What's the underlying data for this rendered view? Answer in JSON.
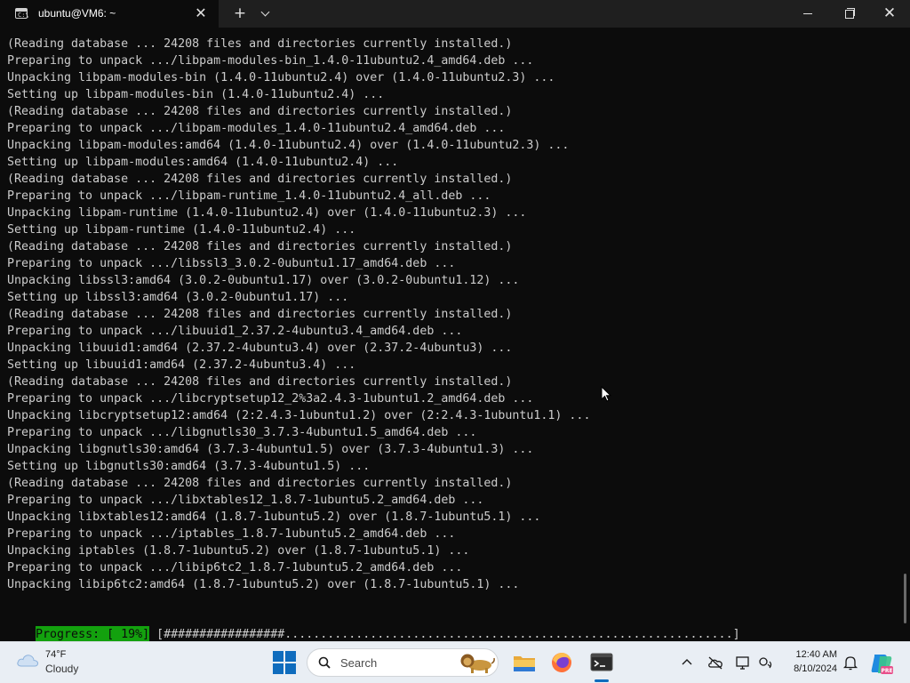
{
  "window": {
    "tab_title": "ubuntu@VM6: ~",
    "tab_icon_text": "C:\\",
    "tab_close_glyph": "✕",
    "new_tab_glyph": "+",
    "close_glyph": "✕"
  },
  "terminal": {
    "lines": [
      "(Reading database ... 24208 files and directories currently installed.)",
      "Preparing to unpack .../libpam-modules-bin_1.4.0-11ubuntu2.4_amd64.deb ...",
      "Unpacking libpam-modules-bin (1.4.0-11ubuntu2.4) over (1.4.0-11ubuntu2.3) ...",
      "Setting up libpam-modules-bin (1.4.0-11ubuntu2.4) ...",
      "(Reading database ... 24208 files and directories currently installed.)",
      "Preparing to unpack .../libpam-modules_1.4.0-11ubuntu2.4_amd64.deb ...",
      "Unpacking libpam-modules:amd64 (1.4.0-11ubuntu2.4) over (1.4.0-11ubuntu2.3) ...",
      "Setting up libpam-modules:amd64 (1.4.0-11ubuntu2.4) ...",
      "(Reading database ... 24208 files and directories currently installed.)",
      "Preparing to unpack .../libpam-runtime_1.4.0-11ubuntu2.4_all.deb ...",
      "Unpacking libpam-runtime (1.4.0-11ubuntu2.4) over (1.4.0-11ubuntu2.3) ...",
      "Setting up libpam-runtime (1.4.0-11ubuntu2.4) ...",
      "(Reading database ... 24208 files and directories currently installed.)",
      "Preparing to unpack .../libssl3_3.0.2-0ubuntu1.17_amd64.deb ...",
      "Unpacking libssl3:amd64 (3.0.2-0ubuntu1.17) over (3.0.2-0ubuntu1.12) ...",
      "Setting up libssl3:amd64 (3.0.2-0ubuntu1.17) ...",
      "(Reading database ... 24208 files and directories currently installed.)",
      "Preparing to unpack .../libuuid1_2.37.2-4ubuntu3.4_amd64.deb ...",
      "Unpacking libuuid1:amd64 (2.37.2-4ubuntu3.4) over (2.37.2-4ubuntu3) ...",
      "Setting up libuuid1:amd64 (2.37.2-4ubuntu3.4) ...",
      "(Reading database ... 24208 files and directories currently installed.)",
      "Preparing to unpack .../libcryptsetup12_2%3a2.4.3-1ubuntu1.2_amd64.deb ...",
      "Unpacking libcryptsetup12:amd64 (2:2.4.3-1ubuntu1.2) over (2:2.4.3-1ubuntu1.1) ...",
      "Preparing to unpack .../libgnutls30_3.7.3-4ubuntu1.5_amd64.deb ...",
      "Unpacking libgnutls30:amd64 (3.7.3-4ubuntu1.5) over (3.7.3-4ubuntu1.3) ...",
      "Setting up libgnutls30:amd64 (3.7.3-4ubuntu1.5) ...",
      "(Reading database ... 24208 files and directories currently installed.)",
      "Preparing to unpack .../libxtables12_1.8.7-1ubuntu5.2_amd64.deb ...",
      "Unpacking libxtables12:amd64 (1.8.7-1ubuntu5.2) over (1.8.7-1ubuntu5.1) ...",
      "Preparing to unpack .../iptables_1.8.7-1ubuntu5.2_amd64.deb ...",
      "Unpacking iptables (1.8.7-1ubuntu5.2) over (1.8.7-1ubuntu5.1) ...",
      "Preparing to unpack .../libip6tc2_1.8.7-1ubuntu5.2_amd64.deb ...",
      "Unpacking libip6tc2:amd64 (1.8.7-1ubuntu5.2) over (1.8.7-1ubuntu5.1) ..."
    ],
    "progress_label": "Progress: [ 19%]",
    "progress_bar": " [#################...............................................................]",
    "progress_percent": 19
  },
  "taskbar": {
    "weather_temp": "74°F",
    "weather_desc": "Cloudy",
    "search_placeholder": "Search",
    "clock_time": "12:40 AM",
    "clock_date": "8/10/2024"
  },
  "colors": {
    "terminal_bg": "#0c0c0c",
    "terminal_fg": "#cccccc",
    "progress_green": "#13a10e",
    "accent": "#0f6cbd"
  },
  "icons": [
    "terminal-icon",
    "close-icon",
    "plus-icon",
    "chevron-down-icon",
    "minimize-icon",
    "maximize-icon",
    "cloud-icon",
    "windows-start-icon",
    "search-icon",
    "lion-icon",
    "folder-icon",
    "firefox-icon",
    "chevron-up-icon",
    "cloud-offline-icon",
    "display-icon",
    "network-volume-icon",
    "bell-icon",
    "copilot-icon"
  ]
}
